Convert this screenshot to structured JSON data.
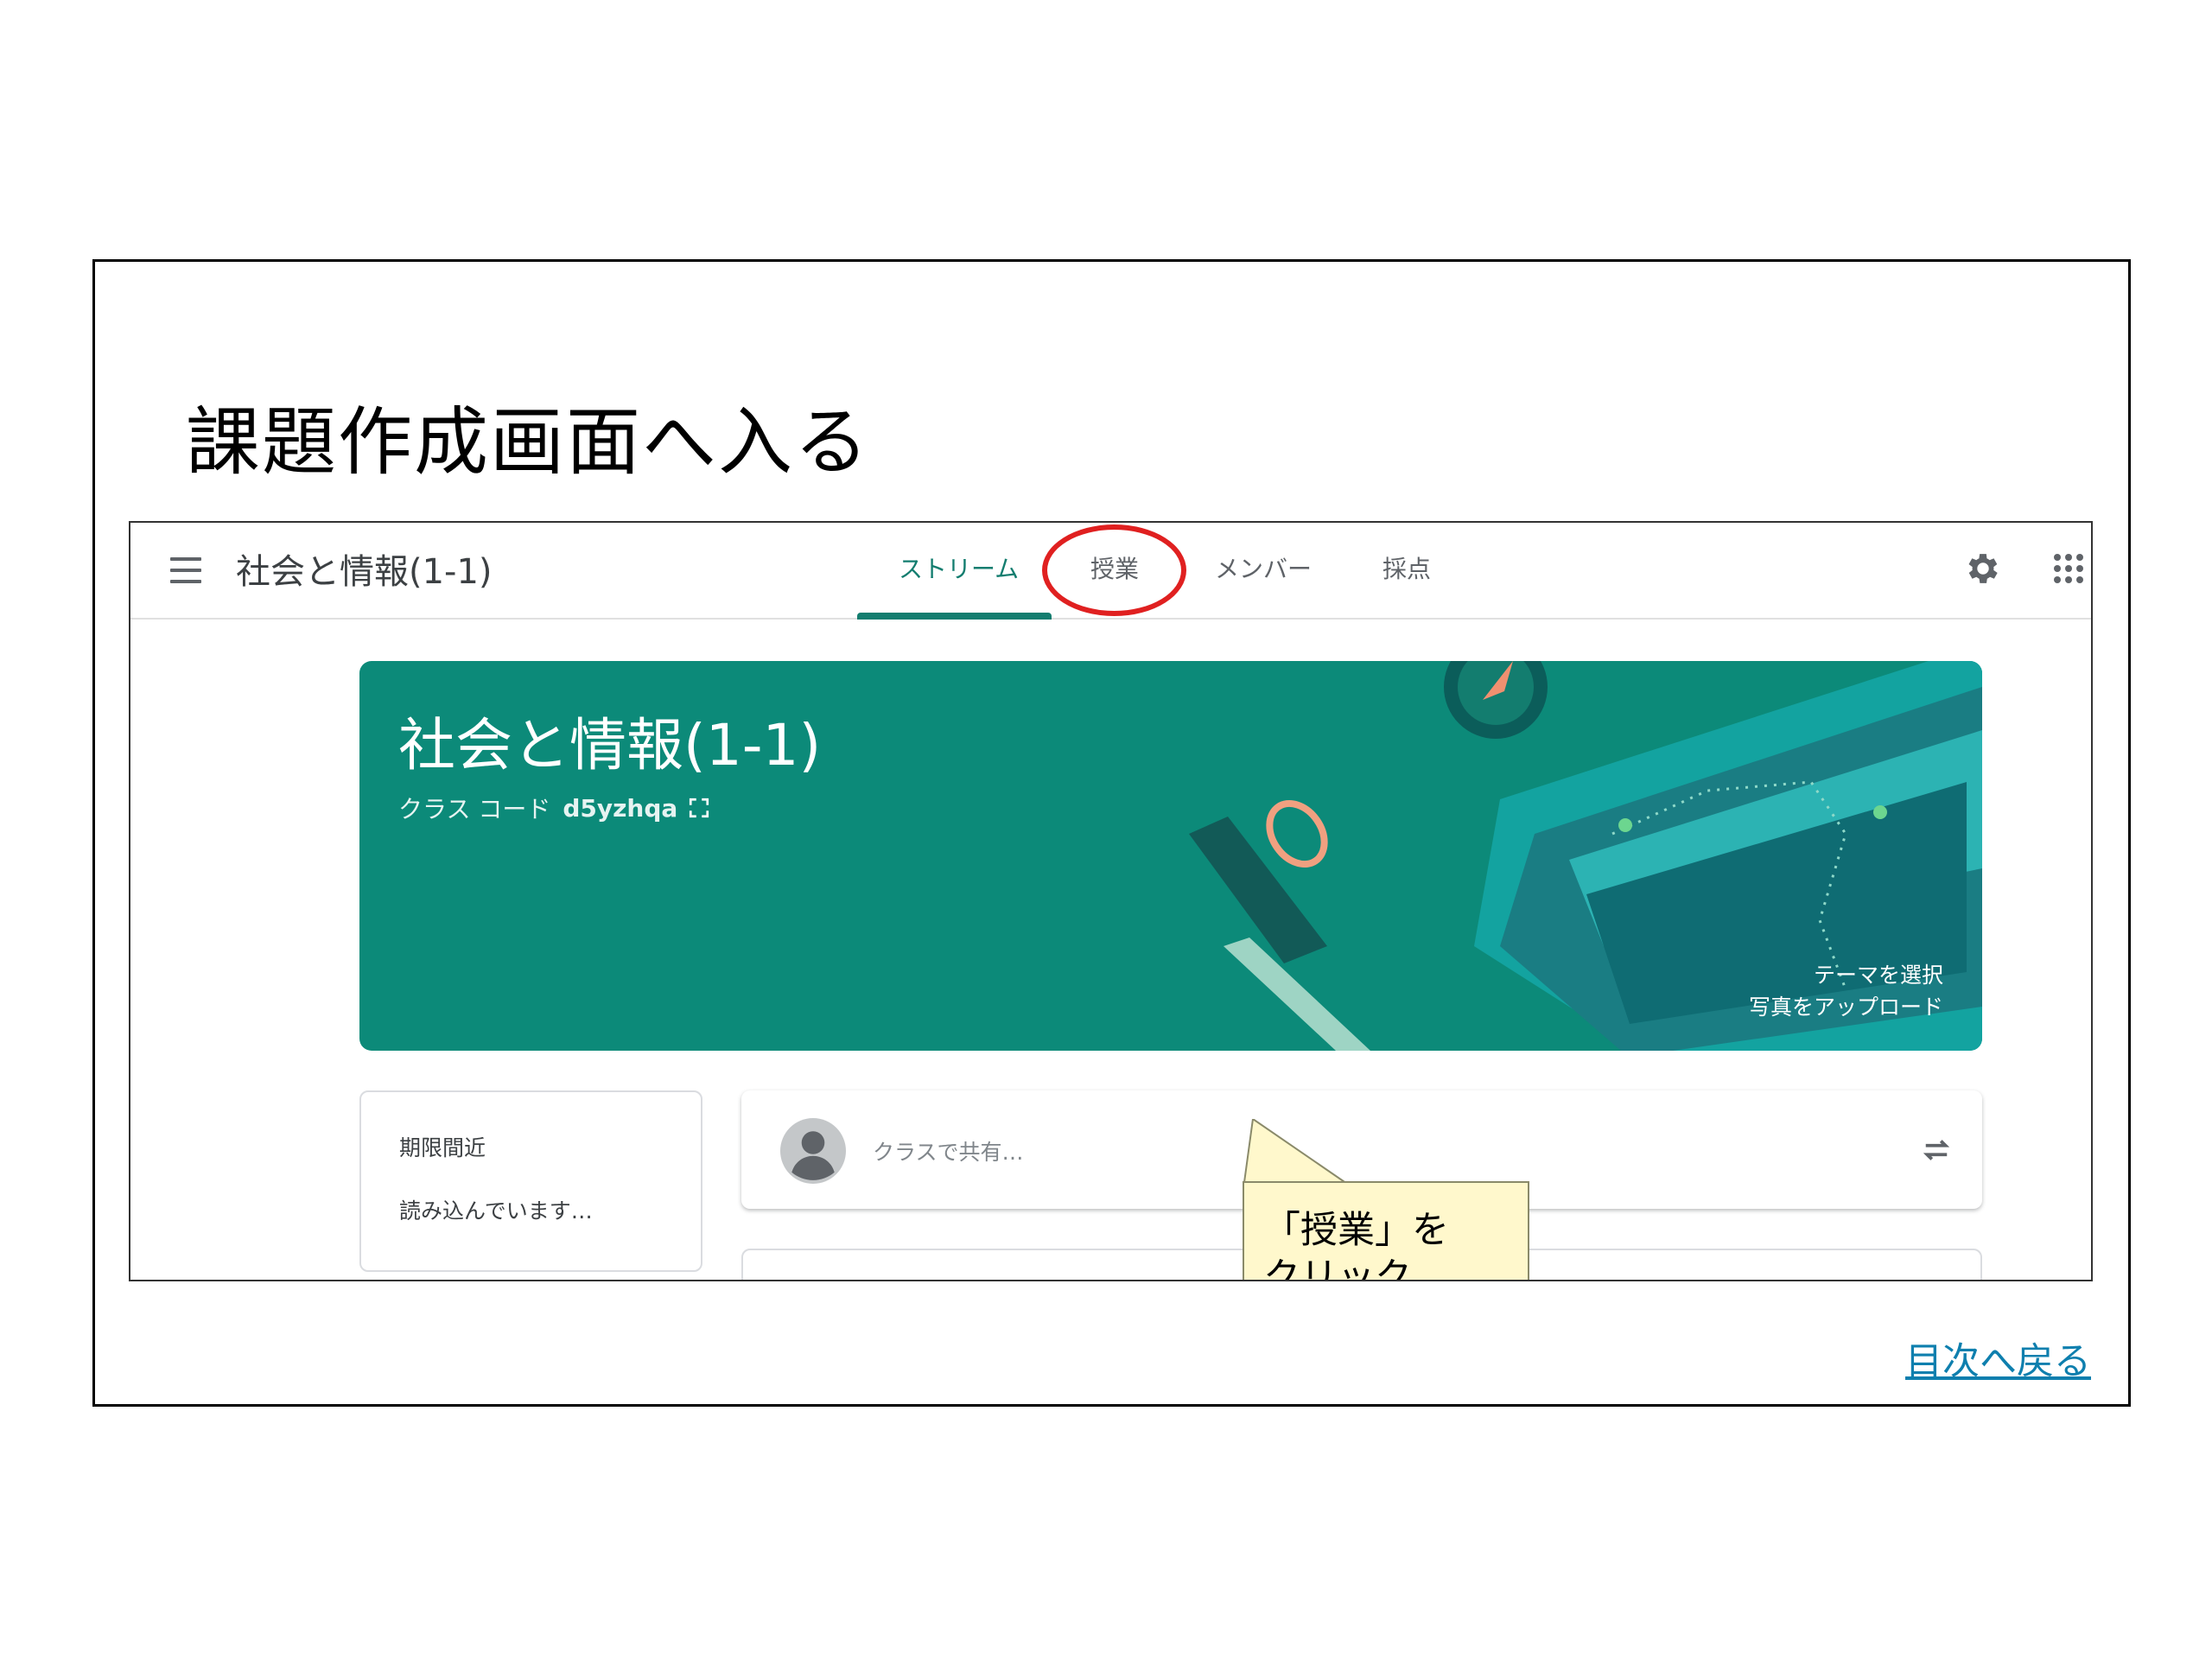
{
  "slide": {
    "title": "課題作成画面へ入る",
    "back_link": "目次へ戻る"
  },
  "classroom": {
    "class_name": "社会と情報(1-1)",
    "tabs": [
      {
        "label": "ストリーム",
        "active": true
      },
      {
        "label": "授業",
        "active": false
      },
      {
        "label": "メンバー",
        "active": false
      },
      {
        "label": "採点",
        "active": false
      }
    ],
    "banner": {
      "title": "社会と情報(1-1)",
      "class_code_label": "クラス コード",
      "class_code": "d5yzhqa",
      "theme_select": "テーマを選択",
      "photo_upload": "写真をアップロード"
    },
    "upcoming": {
      "title": "期限間近",
      "status": "読み込んでいます…"
    },
    "share": {
      "placeholder": "クラスで共有…"
    },
    "icons": [
      "menu-icon",
      "gear-icon",
      "apps-grid-icon",
      "expand-icon",
      "avatar-icon",
      "repost-icon"
    ]
  },
  "callout": {
    "line1": "「授業」を",
    "line2": "クリック"
  },
  "colors": {
    "accent": "#137d6f",
    "banner": "#0c8a79",
    "highlight_ring": "#e02020",
    "callout_bg": "#fff8cc",
    "link": "#0e7fae"
  }
}
